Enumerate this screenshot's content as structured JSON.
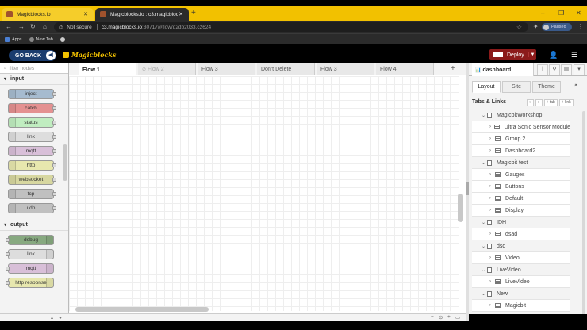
{
  "browser": {
    "tabs": [
      {
        "title": "Magicblocks.io",
        "active": false
      },
      {
        "title": "Magicblocks.io : c3.magicblocks.io",
        "active": true
      }
    ],
    "new_tab": "+",
    "url": {
      "security": "Not secure",
      "host": "c3.magicblocks.io",
      "path": ":30717/#flow/d2db2033.c2624"
    },
    "profile_status": "Paused",
    "bookmarks": [
      {
        "label": "Apps"
      },
      {
        "label": "New Tab"
      }
    ]
  },
  "header": {
    "go_back": "GO BACK",
    "logo": "Magicblocks",
    "deploy": "Deploy"
  },
  "palette": {
    "filter_placeholder": "filter nodes",
    "categories": [
      {
        "name": "input",
        "nodes": [
          "inject",
          "catch",
          "status",
          "link",
          "mqtt",
          "http",
          "websocket",
          "tcp",
          "udp"
        ]
      },
      {
        "name": "output",
        "nodes": [
          "debug",
          "link",
          "mqtt",
          "http response"
        ]
      }
    ],
    "colors": {
      "inject": "#a6bbcf",
      "catch": "#e49191",
      "status": "#c0edc0",
      "link": "#dddddd",
      "mqtt": "#d8bfd8",
      "http": "#e7e7ae",
      "websocket": "#d7d7a0",
      "tcp": "#c0c0c0",
      "udp": "#c0c0c0",
      "debug": "#87a980",
      "http response": "#e7e7ae"
    }
  },
  "workspace": {
    "tabs": [
      {
        "label": "Flow 1",
        "active": true,
        "disabled": false
      },
      {
        "label": "Flow 2",
        "active": false,
        "disabled": true
      },
      {
        "label": "Flow 3",
        "active": false,
        "disabled": false
      },
      {
        "label": "Don't Delete",
        "active": false,
        "disabled": false
      },
      {
        "label": "Flow 3",
        "active": false,
        "disabled": false
      },
      {
        "label": "Flow 4",
        "active": false,
        "disabled": false
      }
    ],
    "add_tab": "+"
  },
  "sidebar": {
    "title": "dashboard",
    "subtabs": [
      "Layout",
      "Site",
      "Theme"
    ],
    "tabs_links_title": "Tabs & Links",
    "tree_buttons": [
      "«",
      "»",
      "+ tab",
      "+ link"
    ],
    "tree": [
      {
        "label": "MagicbitWorkshop",
        "type": "tab"
      },
      {
        "label": "Ultra Sonic Sensor Module",
        "type": "group"
      },
      {
        "label": "Group 2",
        "type": "group"
      },
      {
        "label": "Dashboard2",
        "type": "group"
      },
      {
        "label": "Magicbit test",
        "type": "tab"
      },
      {
        "label": "Gauges",
        "type": "group"
      },
      {
        "label": "Buttons",
        "type": "group"
      },
      {
        "label": "Default",
        "type": "group"
      },
      {
        "label": "Display",
        "type": "group"
      },
      {
        "label": "IDH",
        "type": "tab"
      },
      {
        "label": "dsad",
        "type": "group"
      },
      {
        "label": "dsd",
        "type": "tab"
      },
      {
        "label": "Video",
        "type": "group"
      },
      {
        "label": "LiveVideo",
        "type": "tab"
      },
      {
        "label": "LiveVideo",
        "type": "group"
      },
      {
        "label": "New",
        "type": "tab"
      },
      {
        "label": "Magicbit",
        "type": "group"
      }
    ]
  }
}
